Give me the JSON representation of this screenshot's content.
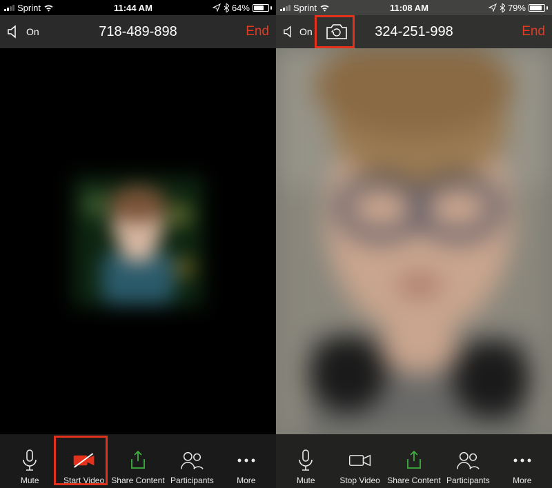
{
  "left": {
    "status": {
      "carrier": "Sprint",
      "time": "11:44 AM",
      "battery_pct": "64%",
      "battery_fill": 64
    },
    "topbar": {
      "speaker_label": "On",
      "meeting_id": "718-489-898",
      "end_label": "End"
    },
    "bottom": {
      "mute": "Mute",
      "video": "Start Video",
      "share": "Share Content",
      "participants": "Participants",
      "more": "More"
    }
  },
  "right": {
    "status": {
      "carrier": "Sprint",
      "time": "11:08 AM",
      "battery_pct": "79%",
      "battery_fill": 79
    },
    "topbar": {
      "speaker_label": "On",
      "meeting_id": "324-251-998",
      "end_label": "End"
    },
    "bottom": {
      "mute": "Mute",
      "video": "Stop Video",
      "share": "Share Content",
      "participants": "Participants",
      "more": "More"
    }
  }
}
